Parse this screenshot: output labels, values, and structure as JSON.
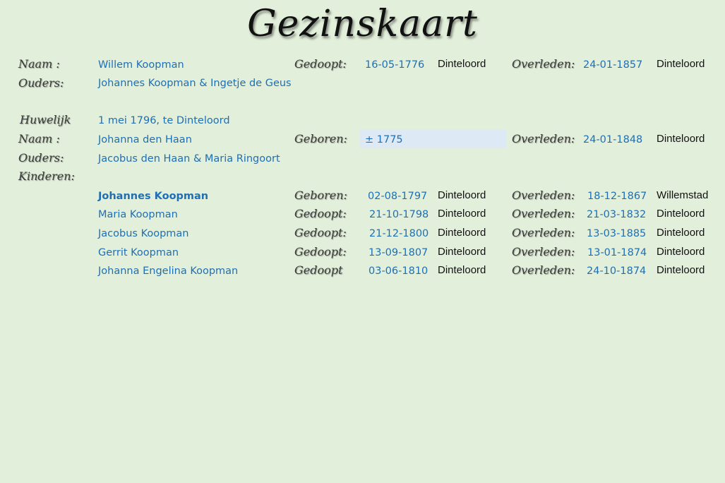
{
  "title": "Gezinskaart",
  "labels": {
    "naam": "Naam :",
    "ouders": "Ouders:",
    "huwelijk": "Huwelijk",
    "kinderen": "Kinderen:",
    "gedoopt": "Gedoopt:",
    "gedoopt_nocolon": "Gedoopt",
    "geboren": "Geboren:",
    "overleden": "Overleden:"
  },
  "person": {
    "name": "Willem Koopman",
    "baptism_date": "16-05-1776",
    "baptism_place": "Dinteloord",
    "death_date": "24-01-1857",
    "death_place": "Dinteloord",
    "parents": "Johannes Koopman & Ingetje de Geus"
  },
  "marriage": "1 mei 1796, te Dinteloord",
  "spouse": {
    "name": "Johanna den Haan",
    "birth": "± 1775",
    "death_date": "24-01-1848",
    "death_place": "Dinteloord",
    "parents": "Jacobus den Haan & Maria Ringoort"
  },
  "children": [
    {
      "name": "Johannes Koopman",
      "event_label": "Geboren:",
      "date": "02-08-1797",
      "place": "Dinteloord",
      "death_date": "18-12-1867",
      "death_place": "Willemstad"
    },
    {
      "name": "Maria Koopman",
      "event_label": "Gedoopt:",
      "date": "21-10-1798",
      "place": "Dinteloord",
      "death_date": "21-03-1832",
      "death_place": "Dinteloord"
    },
    {
      "name": "Jacobus Koopman",
      "event_label": "Gedoopt:",
      "date": "21-12-1800",
      "place": "Dinteloord",
      "death_date": "13-03-1885",
      "death_place": "Dinteloord"
    },
    {
      "name": "Gerrit Koopman",
      "event_label": "Gedoopt:",
      "date": "13-09-1807",
      "place": "Dinteloord",
      "death_date": "13-01-1874",
      "death_place": "Dinteloord"
    },
    {
      "name": "Johanna Engelina Koopman",
      "event_label": "Gedoopt",
      "date": "03-06-1810",
      "place": "Dinteloord",
      "death_date": "24-10-1874",
      "death_place": "Dinteloord"
    }
  ],
  "colors": {
    "background": "#e2efda",
    "value_text": "#1f6fb4",
    "highlight_cell": "#dde9f5"
  }
}
